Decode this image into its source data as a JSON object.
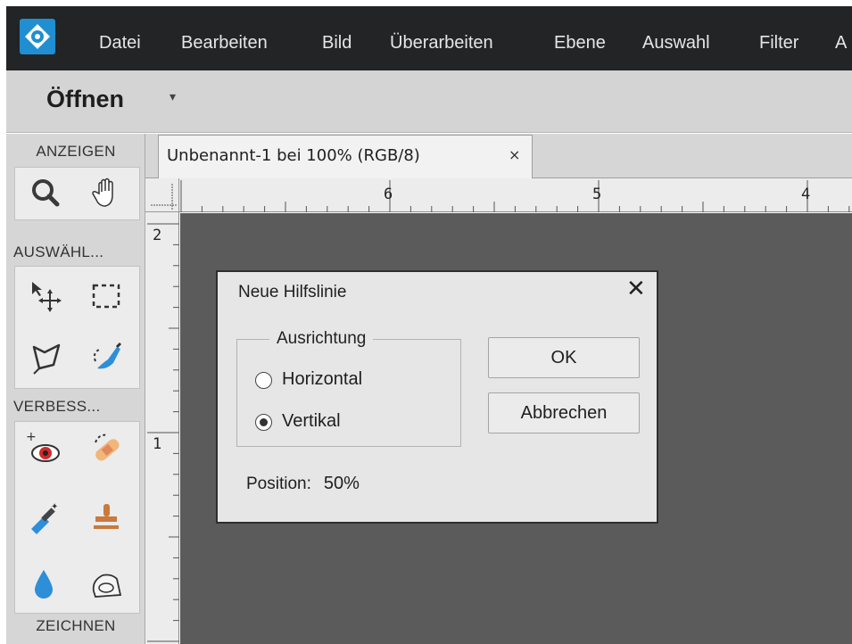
{
  "menubar": {
    "logo": "app-logo-icon",
    "items": [
      "Datei",
      "Bearbeiten",
      "Bild",
      "Überarbeiten",
      "Ebene",
      "Auswahl",
      "Filter",
      "A"
    ]
  },
  "openbar": {
    "label": "Öffnen",
    "dropdown_icon": "▾"
  },
  "toolpanel": {
    "sections": [
      "ANZEIGEN",
      "AUSWÄHL...",
      "VERBESS...",
      "ZEICHNEN"
    ],
    "tools": [
      "zoom-icon",
      "hand-icon",
      "move-icon",
      "rectangular-marquee-icon",
      "lasso-icon",
      "quick-selection-icon",
      "red-eye-icon",
      "spot-healing-icon",
      "smart-brush-icon",
      "clone-stamp-icon",
      "blur-icon",
      "smudge-icon"
    ]
  },
  "document": {
    "tab_label": "Unbenannt-1 bei 100% (RGB/8)",
    "tab_close": "×",
    "ruler_h": [
      "6",
      "5",
      "4"
    ],
    "ruler_v": [
      "2",
      "1"
    ]
  },
  "dialog": {
    "title": "Neue Hilfslinie",
    "close": "✕",
    "group_label": "Ausrichtung",
    "options": [
      {
        "label": "Horizontal",
        "checked": false
      },
      {
        "label": "Vertikal",
        "checked": true
      }
    ],
    "ok_label": "OK",
    "cancel_label": "Abbrechen",
    "position_label": "Position:",
    "position_value": "50%"
  },
  "colors": {
    "menubar": "#222426",
    "canvas": "#5b5b5b",
    "logo": "#1f8fd1"
  }
}
